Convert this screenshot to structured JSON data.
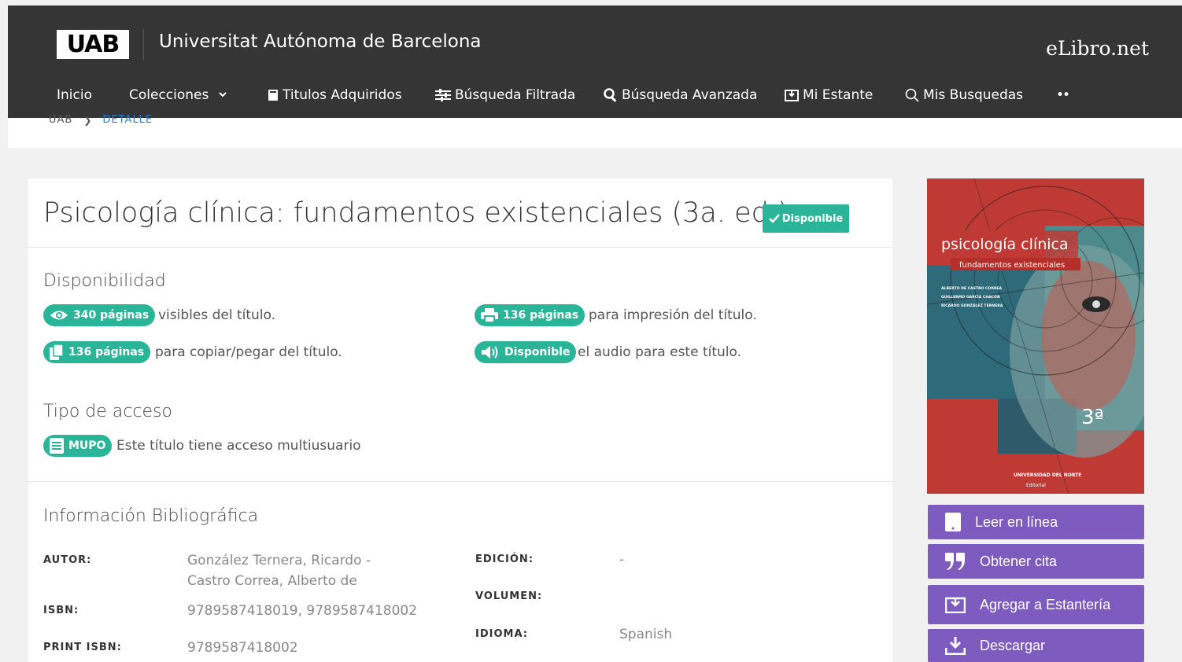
{
  "header": {
    "logo": "UAB",
    "university": "Universitat Autónoma de Barcelona",
    "brand": "eLibro.net",
    "nav": [
      {
        "label": "Inicio"
      },
      {
        "label": "Colecciones"
      },
      {
        "label": "Titulos Adquiridos"
      },
      {
        "label": "Búsqueda Filtrada"
      },
      {
        "label": "Búsqueda Avanzada"
      },
      {
        "label": "Mi Estante"
      },
      {
        "label": "Mis Busquedas"
      },
      {
        "label": "••"
      }
    ]
  },
  "breadcrumb": {
    "root": "UAB",
    "current": "DETALLE"
  },
  "book": {
    "title": "Psicología clínica: fundamentos existenciales (3a. ed.)",
    "status": "Disponible"
  },
  "availability": {
    "heading": "Disponibilidad",
    "items": [
      {
        "badge": "340 páginas",
        "text": "visibles del título.",
        "icon": "eye-icon"
      },
      {
        "badge": "136 páginas",
        "text": "para impresión del título.",
        "icon": "print-icon"
      },
      {
        "badge": "136 páginas",
        "text": "para copiar/pegar del título.",
        "icon": "copy-icon"
      },
      {
        "badge": "Disponible",
        "text": "el audio para este título.",
        "icon": "audio-icon"
      }
    ]
  },
  "access": {
    "heading": "Tipo de acceso",
    "badge": "MUPO",
    "text": "Este título tiene acceso multiusuario"
  },
  "bibliography": {
    "heading": "Información Bibliográfica",
    "autor_label": "AUTOR:",
    "autor_value": "González Ternera, Ricardo - Castro Correa, Alberto de",
    "isbn_label": "ISBN:",
    "isbn_value": "9789587418019, 9789587418002",
    "print_isbn_label": "PRINT ISBN:",
    "print_isbn_value": "9789587418002",
    "edicion_label": "EDICIÓN:",
    "edicion_value": "-",
    "volumen_label": "VOLUMEN:",
    "volumen_value": "",
    "idioma_label": "IDIOMA:",
    "idioma_value": "Spanish"
  },
  "cover": {
    "title": "psicología clínica",
    "subtitle": "fundamentos existenciales",
    "authors": [
      "ALBERTO DE CASTRO CORREA",
      "GUILLERMO GARCÍA CHACÓN",
      "RICARDO GONZÁLEZ TERNERA"
    ],
    "edition": "3ª",
    "publisher": "UNIVERSIDAD DEL NORTE",
    "publisher_sub": "Editorial"
  },
  "actions": [
    {
      "label": "Leer en línea"
    },
    {
      "label": "Obtener cita"
    },
    {
      "label": "Agregar a Estantería"
    },
    {
      "label": "Descargar"
    }
  ],
  "colors": {
    "header": "#353535",
    "accent": "#2bb598",
    "action": "#7e5bbe",
    "link": "#2a7fd0"
  }
}
